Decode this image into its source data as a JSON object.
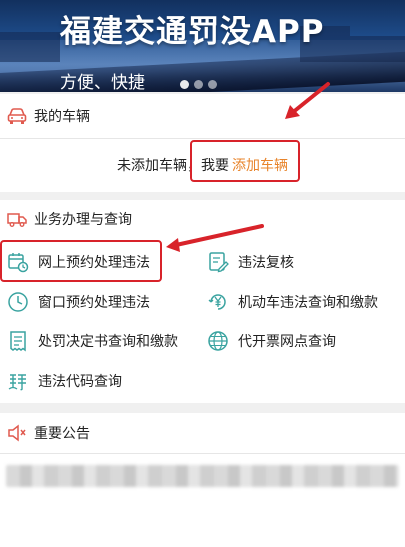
{
  "banner": {
    "title": "福建交通罚没APP",
    "subtitle": "方便、快捷"
  },
  "my_vehicle": {
    "title": "我的车辆",
    "empty_text": "未添加车辆，我要",
    "add_link": "添加车辆"
  },
  "services": {
    "title": "业务办理与查询",
    "items": [
      {
        "label": "网上预约处理违法",
        "icon": "calendar-clock-icon"
      },
      {
        "label": "违法复核",
        "icon": "edit-document-icon"
      },
      {
        "label": "窗口预约处理违法",
        "icon": "clock-icon"
      },
      {
        "label": "机动车违法查询和缴款",
        "icon": "yen-coin-icon"
      },
      {
        "label": "处罚决定书查询和缴款",
        "icon": "receipt-icon"
      },
      {
        "label": "代开票网点查询",
        "icon": "globe-icon"
      },
      {
        "label": "违法代码查询",
        "icon": "code-lookup-icon"
      }
    ]
  },
  "notice": {
    "title": "重要公告"
  },
  "colors": {
    "accent_orange": "#e8842b",
    "icon_red": "#e05a4f",
    "icon_teal": "#3aa3a0",
    "annotation_red": "#d8232a"
  }
}
